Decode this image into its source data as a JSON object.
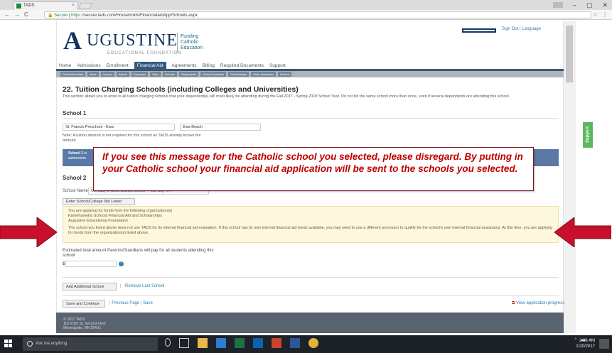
{
  "browser": {
    "tab_title": "TADS",
    "tab_close": "×",
    "url_secure": "Secure",
    "url_scheme": "https://",
    "url_rest": "secure.tads.com/Households/FinancialAidApp/Schools.aspx",
    "window_controls": [
      "–",
      "▢",
      "✕"
    ],
    "nav_icons": [
      "←",
      "→",
      "C"
    ],
    "url_actions": [
      "☆",
      "⋮"
    ]
  },
  "header": {
    "logo_initial": "A",
    "logo_main": "UGUSTINE",
    "logo_sub": "EDUCATIONAL FOUNDATION",
    "logo_tag": [
      "Funding",
      "Catholic",
      "Education"
    ],
    "top_links": "Sign Out | Language"
  },
  "mainnav": {
    "items": [
      "Home",
      "Admissions",
      "Enrollment",
      "Financial Aid",
      "Agreements",
      "Billing",
      "Required Documents",
      "Support"
    ],
    "active": "Financial Aid"
  },
  "steps": [
    "Parent/Guardian",
    "Work",
    "Income",
    "Assets",
    "Expenses",
    "Misc",
    "Schools",
    "Dependents",
    "School Selection",
    "Scholarships",
    "Other Questions",
    "Review"
  ],
  "page": {
    "title": "22. Tuition Charging Schools (including Colleges and Universities)",
    "intro": "This section allows you to enter in all tuition charging schools that your dependent(s) will most likely be attending during the Fall 2017 - Spring 2018 School Year. Do not list the same school more than once, even if several dependents are attending this school.",
    "school1": {
      "heading": "School 1",
      "name": "St. Francis Preschool - Ewa",
      "city": "Ewa Beach",
      "note": "Note: A tuition amount is not required for this school as TADS already knows the amount."
    },
    "bluebox": {
      "bold": "School 1",
      "line1": " is",
      "line2": "submission"
    },
    "school2": {
      "heading": "School 2",
      "name_label": "School Name",
      "name_value": "Our Lady of Good Counsel School - Pearl City, HI",
      "not_listed_btn": "Enter School/College Not Listed"
    },
    "warning": {
      "p1": [
        "You are applying for funds from the following organization(s)",
        "Kamehameha Schools Financial Aid and Scholarships",
        "Augustine Educational Foundation"
      ],
      "p2": "The school you listed above does not use TADS for its internal financial aid evaluation. If this school has its own internal financial aid funds available, you may need to use a different processor to qualify for the school's own internal financial assistance. At this time, you are applying for funds from the organization(s) listed above."
    },
    "estimate": {
      "label": "Estimated total amount Parents/Guardians will pay for all students attending this school",
      "currency": "$",
      "help": "?"
    },
    "add_school_btn": "Add Additional School",
    "separator": "|",
    "remove_school": "Remove Last School",
    "save_continue_btn": "Save and Continue",
    "previous_page": "Previous Page",
    "save": "Save",
    "view_progress": "View application progress"
  },
  "footer": {
    "lines": [
      "© 2017 TADS",
      "110 N 5th St. Second Floor",
      "Minneapolis, MN 55403"
    ]
  },
  "support_tab": "Support",
  "annotation": {
    "text": "If you see this message for the Catholic school you selected, please disregard. By putting in your Catholic school your financial aid application will be sent to the schools you selected."
  },
  "taskbar": {
    "search_placeholder": "Ask me anything",
    "time": "2:38 AM",
    "date": "1/20/2017"
  },
  "colors": {
    "brand_navy": "#14335f",
    "nav_active": "#33597e",
    "annotation_red": "#c00000",
    "arrow_red": "#c8102e",
    "support_green": "#5cb85c",
    "warning_bg": "#fcf7dd"
  }
}
